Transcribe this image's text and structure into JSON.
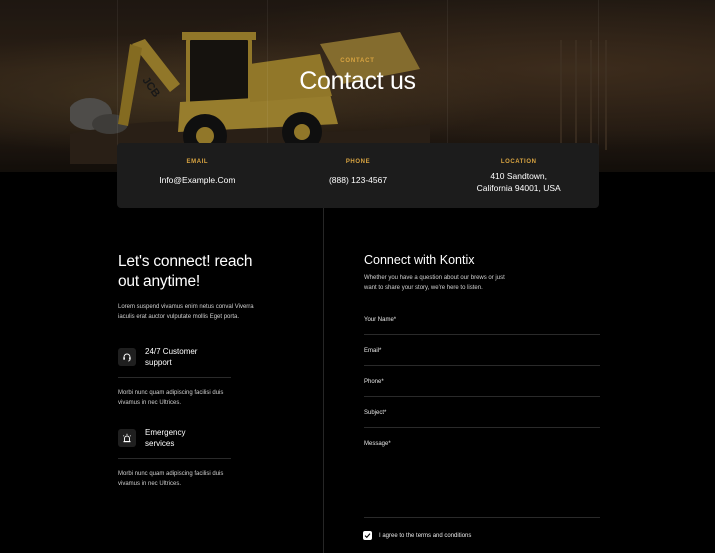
{
  "hero": {
    "eyebrow": "CONTACT",
    "title": "Contact us",
    "image_icon": "excavator-photo"
  },
  "info": {
    "email": {
      "label": "EMAIL",
      "value": "Info@Example.Com"
    },
    "phone": {
      "label": "PHONE",
      "value": "(888) 123-4567"
    },
    "location": {
      "label": "LOCATION",
      "line1": "410 Sandtown,",
      "line2": "California 94001, USA"
    }
  },
  "left": {
    "heading_line1": "Let's connect! reach",
    "heading_line2": "out anytime!",
    "intro": "Lorem suspend vivamus enim netus conval Viverra iaculis erat auctor vulputate mollis Eget porta.",
    "features": [
      {
        "icon": "headset-icon",
        "title_line1": "24/7 Customer",
        "title_line2": "support",
        "desc": "Morbi nunc quam adipiscing facilisi duis vivamus in nec Ultrices."
      },
      {
        "icon": "siren-icon",
        "title_line1": "Emergency",
        "title_line2": "services",
        "desc": "Morbi nunc quam adipiscing facilisi duis vivamus in nec Ultrices."
      }
    ]
  },
  "form": {
    "title": "Connect with Kontix",
    "subtitle": "Whether you have a question about our brews or just want to share your story, we're here to listen.",
    "fields": {
      "name": "Your Name*",
      "email": "Email*",
      "phone": "Phone*",
      "subject": "Subject*",
      "message": "Message*"
    },
    "agree_label": "I agree to the terms and conditions",
    "agree_checked": true
  },
  "colors": {
    "accent": "#d9a441",
    "card": "#1c1c1c",
    "background": "#000000"
  }
}
